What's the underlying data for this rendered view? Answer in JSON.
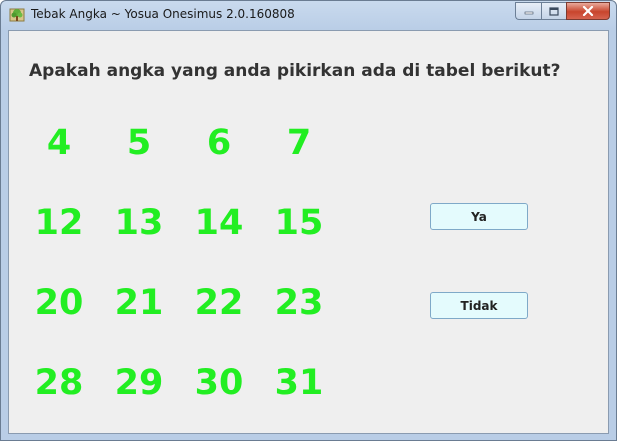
{
  "window": {
    "title": "Tebak Angka ~ Yosua Onesimus 2.0.160808",
    "icon": "app-tree-icon",
    "controls": [
      "minimize-icon",
      "maximize-icon",
      "close-icon"
    ]
  },
  "main": {
    "question": "Apakah angka yang anda pikirkan ada di tabel berikut?",
    "number_color": "#22ee22",
    "numbers": [
      [
        "4",
        "5",
        "6",
        "7"
      ],
      [
        "12",
        "13",
        "14",
        "15"
      ],
      [
        "20",
        "21",
        "22",
        "23"
      ],
      [
        "28",
        "29",
        "30",
        "31"
      ]
    ],
    "buttons": {
      "yes_label": "Ya",
      "no_label": "Tidak"
    }
  }
}
